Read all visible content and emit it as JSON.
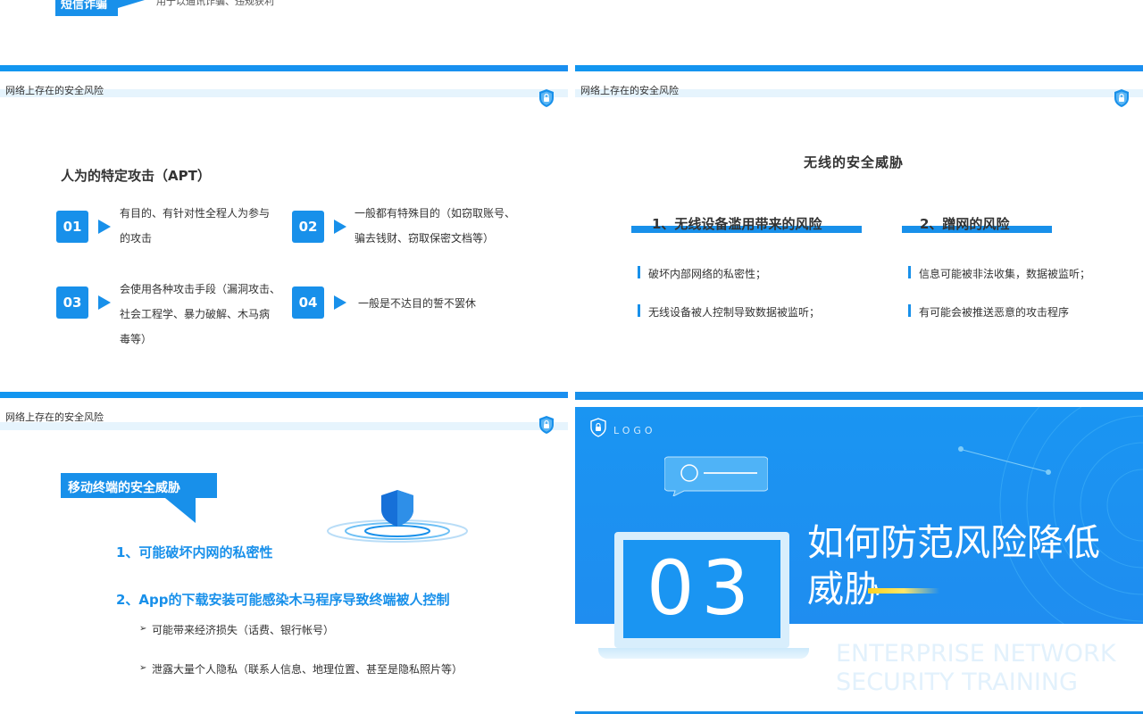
{
  "top_strip": {
    "banner_label": "短信诈骗",
    "note": "用于以通讯诈骗、违规获利"
  },
  "slide_apt": {
    "header": "网络上存在的安全风险",
    "title": "人为的特定攻击（APT）",
    "items": [
      {
        "num": "01",
        "lines": [
          "有目的、有针对性全程人为参与",
          "的攻击"
        ]
      },
      {
        "num": "02",
        "lines": [
          "一般都有特殊目的（如窃取账号、",
          "骗去钱财、窃取保密文档等）"
        ]
      },
      {
        "num": "03",
        "lines": [
          "会使用各种攻击手段（漏洞攻击、",
          "社会工程学、暴力破解、木马病",
          "毒等）"
        ]
      },
      {
        "num": "04",
        "lines": [
          "一般是不达目的誓不罢休"
        ]
      }
    ]
  },
  "slide_wireless": {
    "header": "网络上存在的安全风险",
    "title": "无线的安全威胁",
    "col1": {
      "heading": "1、无线设备滥用带来的风险",
      "bullets": [
        "破坏内部网络的私密性；",
        "无线设备被人控制导致数据被监听；"
      ]
    },
    "col2": {
      "heading": "2、蹭网的风险",
      "bullets": [
        "信息可能被非法收集，数据被监听；",
        "有可能会被推送恶意的攻击程序"
      ]
    }
  },
  "slide_mobile": {
    "header": "网络上存在的安全风险",
    "banner": "移动终端的安全威胁",
    "point1": "1、可能破坏内网的私密性",
    "point2": "2、App的下载安装可能感染木马程序导致终端被人控制",
    "subs": [
      "可能带来经济损失（话费、银行帐号）",
      "泄露大量个人隐私（联系人信息、地理位置、甚至是隐私照片等）"
    ]
  },
  "slide_section": {
    "logo": "LOGO",
    "number": "03",
    "title_line1": "如何防范风险降低",
    "title_line2": "威胁",
    "en_line1": "ENTERPRISE NETWORK",
    "en_line2": "SECURITY TRAINING"
  },
  "colors": {
    "accent": "#1890ea",
    "light": "#e6f4fd",
    "section_bg": "#1a95f2"
  }
}
